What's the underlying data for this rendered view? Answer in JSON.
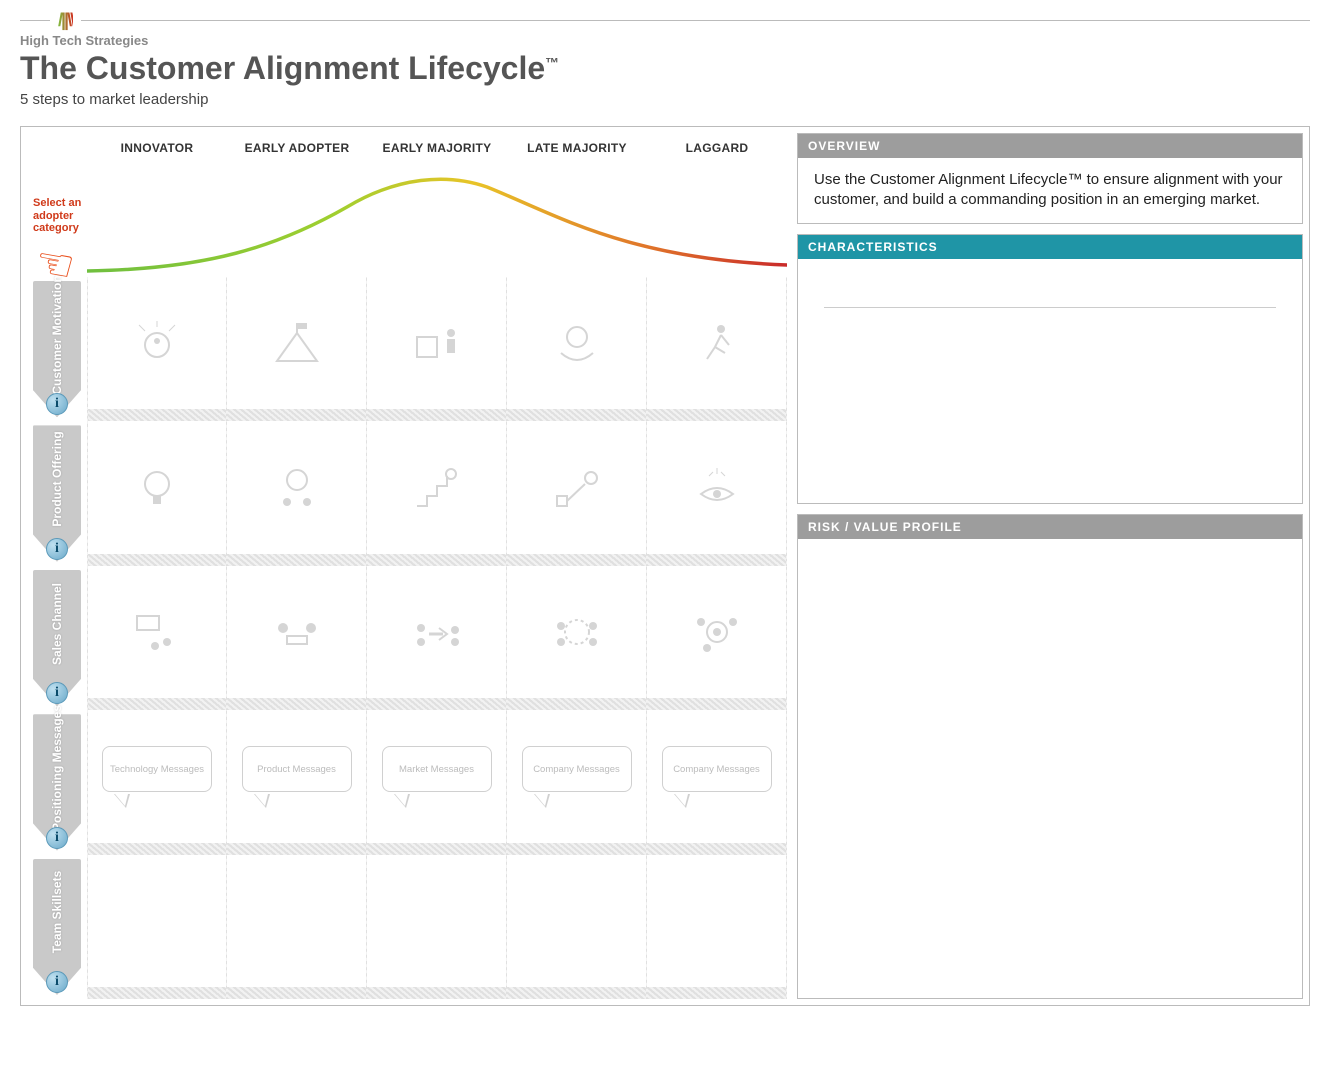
{
  "brand": {
    "name": "High Tech Strategies"
  },
  "title": "The Customer Alignment Lifecycle",
  "trademark": "™",
  "subtitle": "5 steps to market leadership",
  "callout": "Select an adopter category",
  "columns": [
    "INNOVATOR",
    "EARLY ADOPTER",
    "EARLY MAJORITY",
    "LATE MAJORITY",
    "LAGGARD"
  ],
  "rows": [
    {
      "label": "Customer Motivation"
    },
    {
      "label": "Product Offering"
    },
    {
      "label": "Sales Channel"
    },
    {
      "label": "Positioning Messages",
      "cells": [
        "Technology Messages",
        "Product Messages",
        "Market Messages",
        "Company Messages",
        "Company Messages"
      ]
    },
    {
      "label": "Team Skillsets"
    }
  ],
  "panels": {
    "overview": {
      "head": "OVERVIEW",
      "body": "Use the Customer Alignment Lifecycle™ to ensure alignment with your customer, and build a commanding position in an emerging market."
    },
    "characteristics": {
      "head": "CHARACTERISTICS"
    },
    "risk": {
      "head": "RISK / VALUE PROFILE"
    }
  },
  "info_glyph": "i",
  "colors": {
    "accent_orange": "#e94e1b",
    "accent_teal": "#1f95a6",
    "grey": "#9d9d9d"
  },
  "chart_data": {
    "type": "line",
    "title": "Adoption bell curve",
    "categories": [
      "INNOVATOR",
      "EARLY ADOPTER",
      "EARLY MAJORITY",
      "LATE MAJORITY",
      "LAGGARD"
    ],
    "values_relative": [
      0.05,
      0.45,
      1.0,
      0.55,
      0.08
    ],
    "note": "Approximate normalized heights read from curve (1.0 = peak at Early Majority)"
  }
}
